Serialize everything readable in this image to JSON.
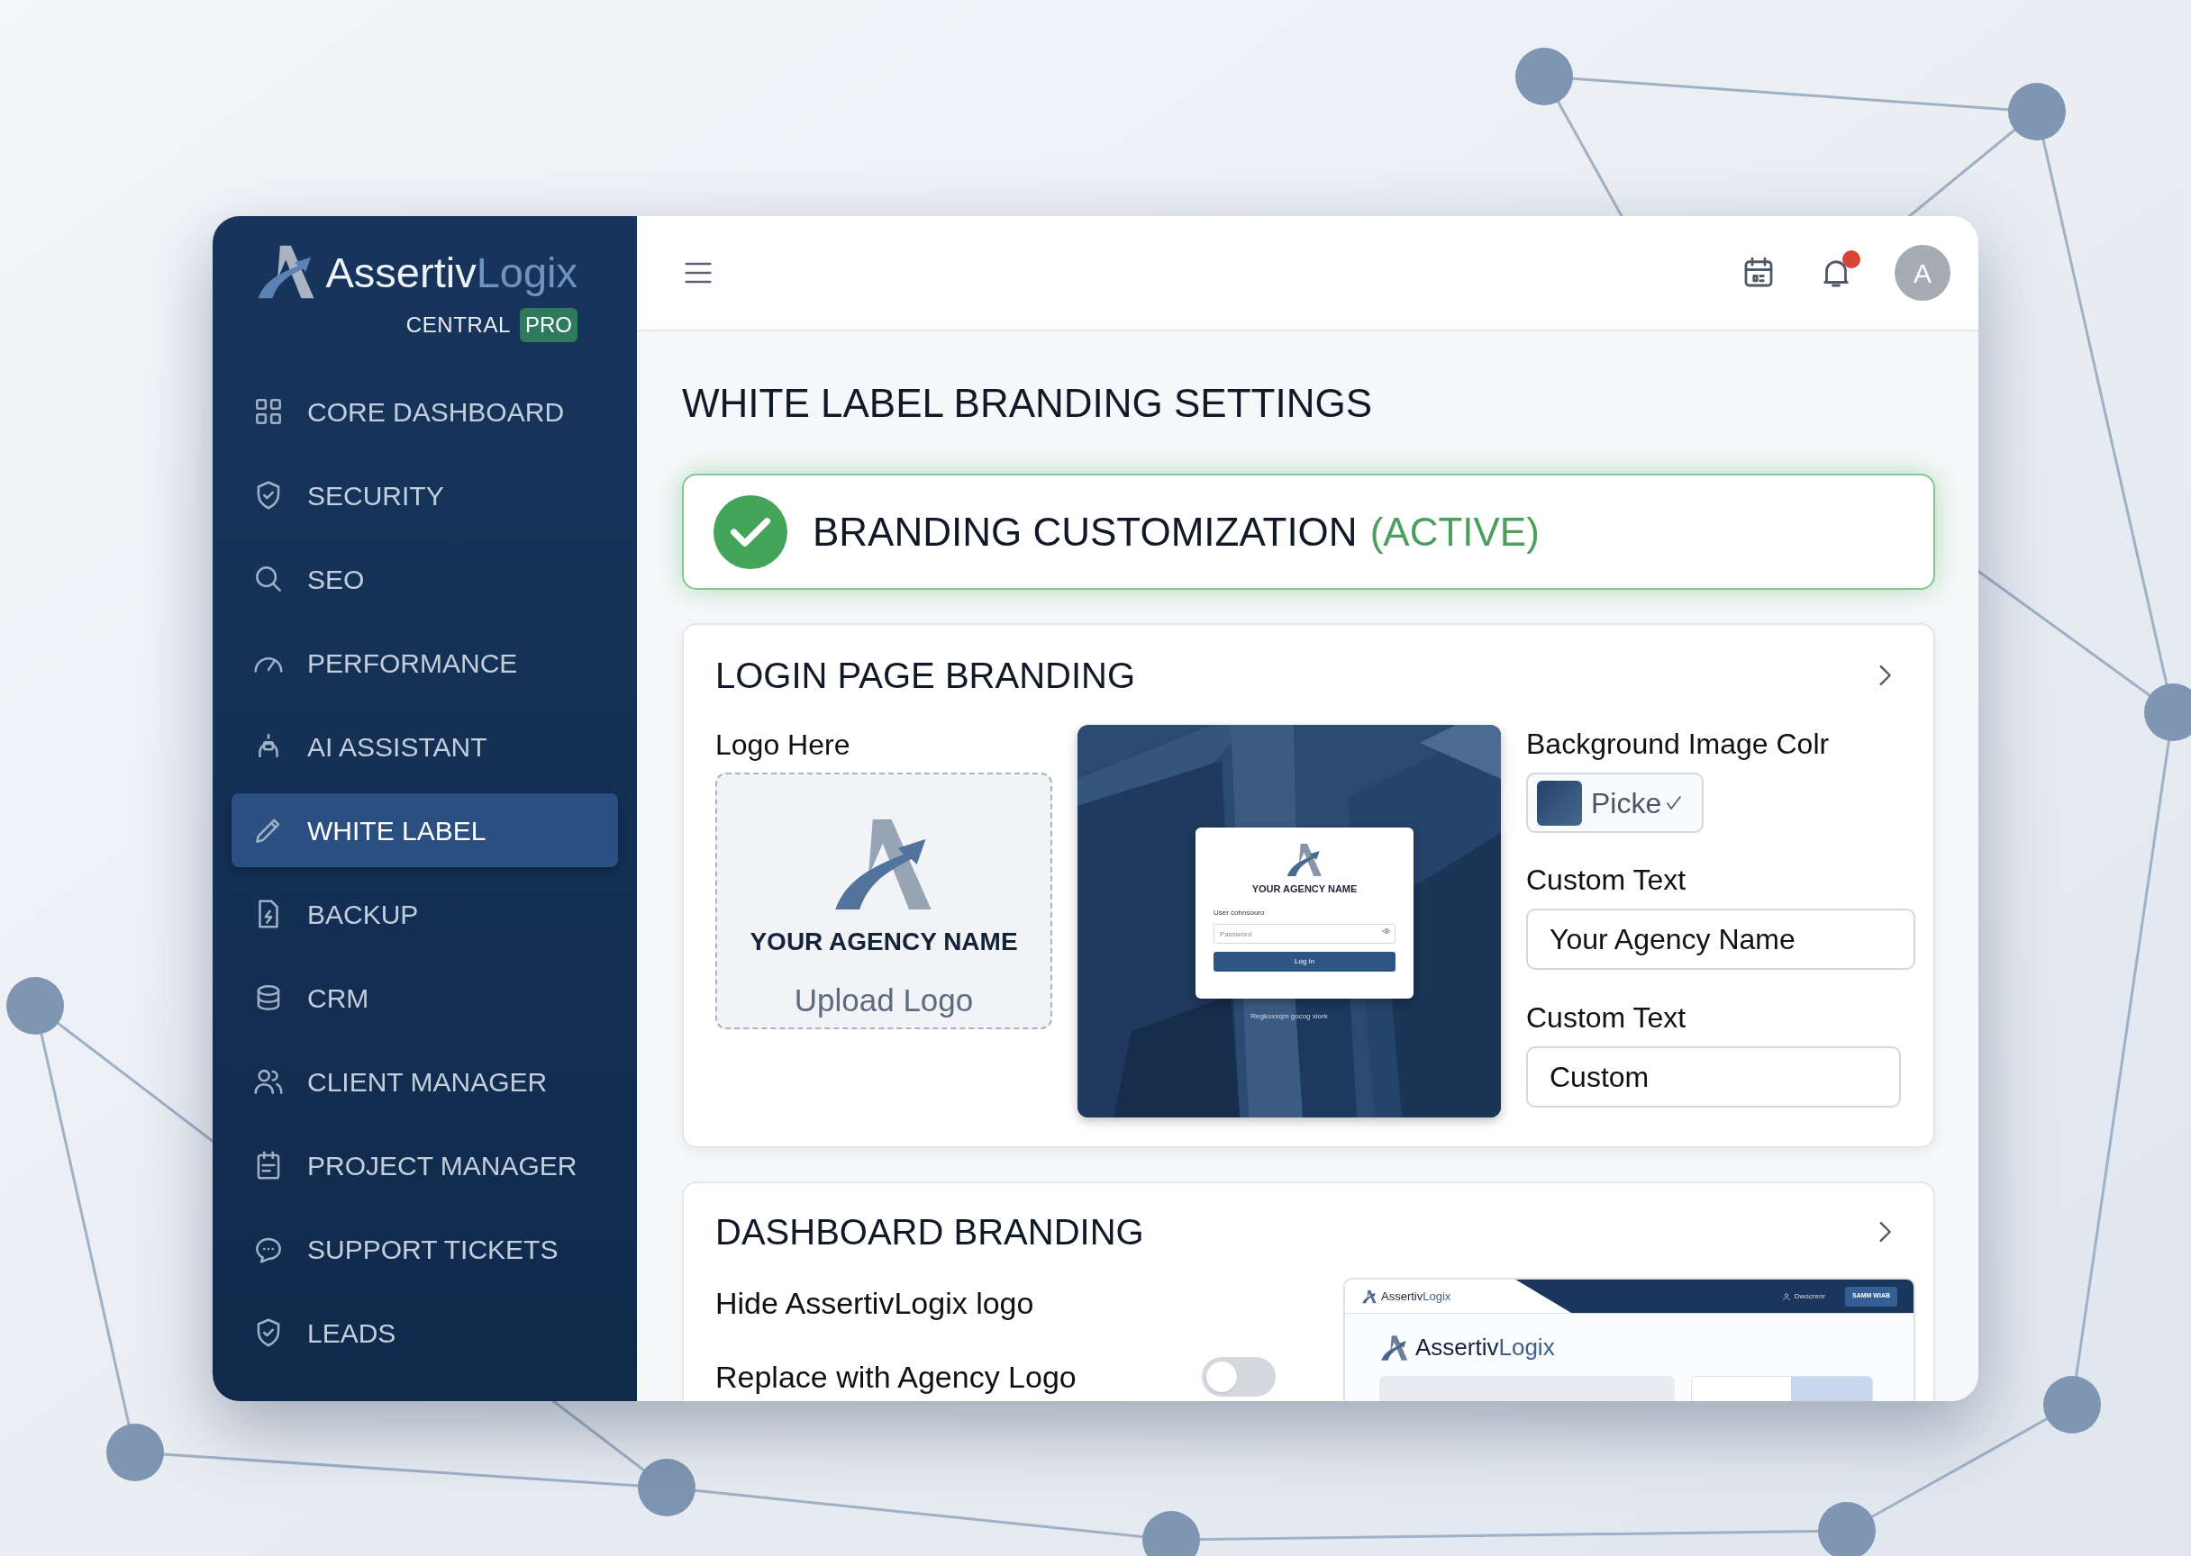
{
  "brand": {
    "name": "Assertiv",
    "name_accent": "Logix",
    "subtitle": "CENTRAL",
    "badge": "PRO"
  },
  "sidebar": {
    "items": [
      {
        "label": "CORE DASHBOARD",
        "selected": false
      },
      {
        "label": "SECURITY",
        "selected": false
      },
      {
        "label": "SEO",
        "selected": false
      },
      {
        "label": "PERFORMANCE",
        "selected": false
      },
      {
        "label": "AI ASSISTANT",
        "selected": false
      },
      {
        "label": "WHITE LABEL",
        "selected": true
      },
      {
        "label": "BACKUP",
        "selected": false
      },
      {
        "label": "CRM",
        "selected": false
      },
      {
        "label": "CLIENT MANAGER",
        "selected": false
      },
      {
        "label": "PROJECT MANAGER",
        "selected": false
      },
      {
        "label": "SUPPORT TICKETS",
        "selected": false
      },
      {
        "label": "LEADS",
        "selected": false
      }
    ]
  },
  "topbar": {
    "unread_notifications": true,
    "avatar_initial": "A"
  },
  "page_title": "WHITE LABEL BRANDING SETTINGS",
  "status_banner": {
    "label": "BRANDING CUSTOMIZATION",
    "status": "(ACTIVE)",
    "active": true
  },
  "login_page_branding": {
    "title": "LOGIN PAGE BRANDING",
    "logo_label": "Logo Here",
    "logo_text": "YOUR AGENCY NAME",
    "upload_label": "Upload Logo",
    "preview": {
      "agency_name": "YOUR AGENCY NAME",
      "field_label": "User cohnsouro",
      "password_placeholder": "Password",
      "button": "Log in",
      "footer": "Regkoxxqm gocog xiork"
    },
    "background_label": "Background Image Colr",
    "picker_label": "Picke",
    "fields": [
      {
        "label": "Custom Text",
        "value": "Your Agency Name"
      },
      {
        "label": "Custom Text",
        "value": "Custom"
      }
    ]
  },
  "dashboard_branding": {
    "title": "DASHBOARD BRANDING",
    "options": [
      {
        "kind": "text",
        "label": "Hide AssertivLogix logo"
      },
      {
        "kind": "toggle",
        "label": "Replace with Agency Logo",
        "on": false
      }
    ],
    "preview": {
      "header_logo_name": "Assertiv",
      "header_logo_accent": "Logix",
      "header_link": "Dwocrenr",
      "header_button": "SAMM WIAB",
      "logo_name": "Assertiv",
      "logo_accent": "Logix"
    }
  }
}
